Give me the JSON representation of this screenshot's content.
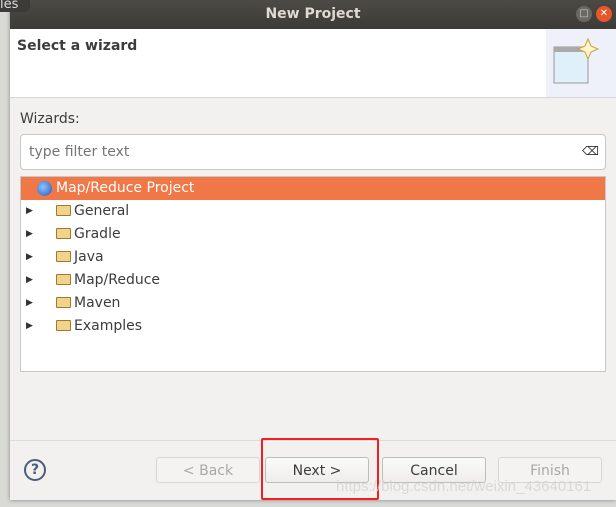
{
  "background": {
    "tab_fragment": "les"
  },
  "window": {
    "title": "New Project"
  },
  "header": {
    "title": "Select a wizard",
    "icon": "new-wizard-icon"
  },
  "wizards_label": "Wizards:",
  "filter": {
    "placeholder": "type filter text",
    "value": "",
    "clear_icon": "clear-icon"
  },
  "tree": {
    "items": [
      {
        "label": "Map/Reduce Project",
        "icon": "mapreduce-project-icon",
        "selected": true
      },
      {
        "label": "General",
        "icon": "folder-icon"
      },
      {
        "label": "Gradle",
        "icon": "folder-icon"
      },
      {
        "label": "Java",
        "icon": "folder-icon"
      },
      {
        "label": "Map/Reduce",
        "icon": "folder-icon"
      },
      {
        "label": "Maven",
        "icon": "folder-icon"
      },
      {
        "label": "Examples",
        "icon": "folder-icon"
      }
    ]
  },
  "buttons": {
    "back": "< Back",
    "next": "Next >",
    "cancel": "Cancel",
    "finish": "Finish"
  },
  "watermark": "https://blog.csdn.net/weixin_43640161",
  "colors": {
    "selection": "#f07746",
    "highlight_box": "#f02020"
  }
}
